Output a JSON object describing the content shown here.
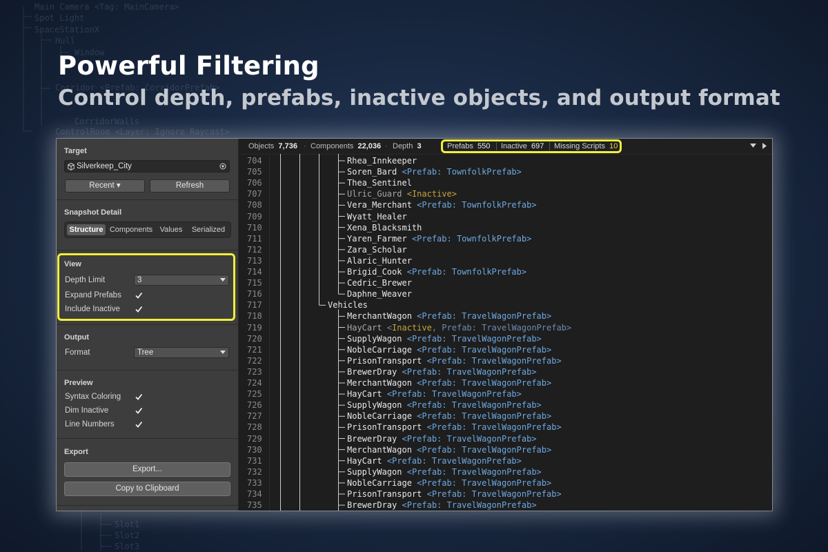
{
  "hero": {
    "title": "Powerful Filtering",
    "subtitle": "Control depth, prefabs, inactive objects, and output format"
  },
  "background_tree": [
    "Main Camera <Tag: MainCamera>",
    "Spot Light",
    "SpaceStationX",
    "Hull",
    "Window",
    "Corridor <Prefab: CorridorPrefab>",
    "CorridorWalls",
    "ControlRoom <Layer: Ignore Raycast>",
    "Slot1",
    "Slot2",
    "Slot3"
  ],
  "panel": {
    "target": {
      "title": "Target",
      "object": "Silverkeep_City",
      "recent_label": "Recent ▾",
      "refresh_label": "Refresh"
    },
    "snapshot": {
      "title": "Snapshot Detail",
      "tabs": [
        "Structure",
        "Components",
        "Values",
        "Serialized"
      ],
      "active_tab": "Structure"
    },
    "view": {
      "title": "View",
      "depth_label": "Depth Limit",
      "depth_value": "3",
      "expand_prefabs_label": "Expand Prefabs",
      "expand_prefabs": true,
      "include_inactive_label": "Include Inactive",
      "include_inactive": true
    },
    "output": {
      "title": "Output",
      "format_label": "Format",
      "format_value": "Tree"
    },
    "preview": {
      "title": "Preview",
      "syntax_coloring_label": "Syntax Coloring",
      "dim_inactive_label": "Dim Inactive",
      "line_numbers_label": "Line Numbers"
    },
    "export": {
      "title": "Export",
      "export_label": "Export...",
      "copy_label": "Copy to Clipboard"
    }
  },
  "stats": {
    "objects_label": "Objects",
    "objects_value": "7,736",
    "components_label": "Components",
    "components_value": "22,036",
    "depth_label": "Depth",
    "depth_value": "3",
    "prefabs_label": "Prefabs",
    "prefabs_value": "550",
    "inactive_label": "Inactive",
    "inactive_value": "697",
    "missing_label": "Missing Scripts",
    "missing_value": "10"
  },
  "tree_lines": [
    {
      "n": "704",
      "name": "Rhea_Innkeeper",
      "tag": ""
    },
    {
      "n": "705",
      "name": "Soren_Bard",
      "tag": "<Prefab: TownfolkPrefab>"
    },
    {
      "n": "706",
      "name": "Thea_Sentinel",
      "tag": ""
    },
    {
      "n": "707",
      "name": "Ulric_Guard",
      "tag": "<Inactive>",
      "inactive": true
    },
    {
      "n": "708",
      "name": "Vera_Merchant",
      "tag": "<Prefab: TownfolkPrefab>"
    },
    {
      "n": "709",
      "name": "Wyatt_Healer",
      "tag": ""
    },
    {
      "n": "710",
      "name": "Xena_Blacksmith",
      "tag": ""
    },
    {
      "n": "711",
      "name": "Yaren_Farmer",
      "tag": "<Prefab: TownfolkPrefab>"
    },
    {
      "n": "712",
      "name": "Zara_Scholar",
      "tag": ""
    },
    {
      "n": "713",
      "name": "Alaric_Hunter",
      "tag": ""
    },
    {
      "n": "714",
      "name": "Brigid_Cook",
      "tag": "<Prefab: TownfolkPrefab>"
    },
    {
      "n": "715",
      "name": "Cedric_Brewer",
      "tag": ""
    },
    {
      "n": "716",
      "name": "Daphne_Weaver",
      "tag": ""
    },
    {
      "n": "717",
      "name": "Vehicles",
      "tag": "",
      "group": true
    },
    {
      "n": "718",
      "name": "MerchantWagon",
      "tag": "<Prefab: TravelWagonPrefab>"
    },
    {
      "n": "719",
      "name": "HayCart",
      "tag": "<Inactive, Prefab: TravelWagonPrefab>",
      "inactive": true
    },
    {
      "n": "720",
      "name": "SupplyWagon",
      "tag": "<Prefab: TravelWagonPrefab>"
    },
    {
      "n": "721",
      "name": "NobleCarriage",
      "tag": "<Prefab: TravelWagonPrefab>"
    },
    {
      "n": "722",
      "name": "PrisonTransport",
      "tag": "<Prefab: TravelWagonPrefab>"
    },
    {
      "n": "723",
      "name": "BrewerDray",
      "tag": "<Prefab: TravelWagonPrefab>"
    },
    {
      "n": "724",
      "name": "MerchantWagon",
      "tag": "<Prefab: TravelWagonPrefab>"
    },
    {
      "n": "725",
      "name": "HayCart",
      "tag": "<Prefab: TravelWagonPrefab>"
    },
    {
      "n": "726",
      "name": "SupplyWagon",
      "tag": "<Prefab: TravelWagonPrefab>"
    },
    {
      "n": "727",
      "name": "NobleCarriage",
      "tag": "<Prefab: TravelWagonPrefab>"
    },
    {
      "n": "728",
      "name": "PrisonTransport",
      "tag": "<Prefab: TravelWagonPrefab>"
    },
    {
      "n": "729",
      "name": "BrewerDray",
      "tag": "<Prefab: TravelWagonPrefab>"
    },
    {
      "n": "730",
      "name": "MerchantWagon",
      "tag": "<Prefab: TravelWagonPrefab>"
    },
    {
      "n": "731",
      "name": "HayCart",
      "tag": "<Prefab: TravelWagonPrefab>"
    },
    {
      "n": "732",
      "name": "SupplyWagon",
      "tag": "<Prefab: TravelWagonPrefab>"
    },
    {
      "n": "733",
      "name": "NobleCarriage",
      "tag": "<Prefab: TravelWagonPrefab>"
    },
    {
      "n": "734",
      "name": "PrisonTransport",
      "tag": "<Prefab: TravelWagonPrefab>"
    },
    {
      "n": "735",
      "name": "BrewerDray",
      "tag": "<Prefab: TravelWagonPrefab>"
    }
  ],
  "colors": {
    "highlight": "#f2ef3a",
    "prefab_tag": "#6ea8e0",
    "inactive_tag": "#c7a53a",
    "warning_count": "#f3d047"
  }
}
